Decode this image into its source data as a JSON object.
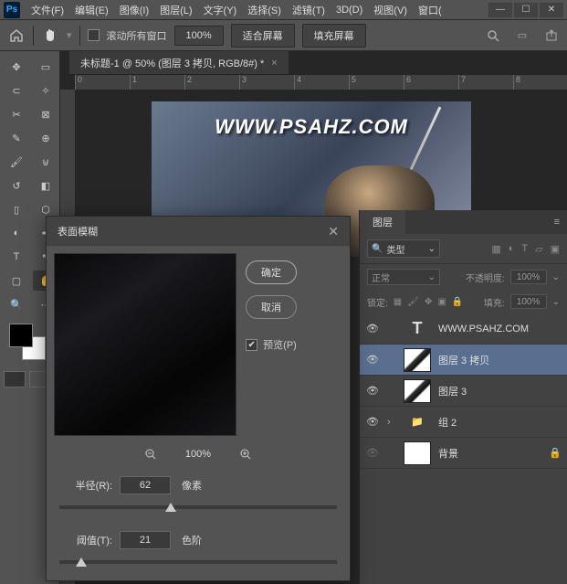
{
  "menubar": {
    "items": [
      "文件(F)",
      "编辑(E)",
      "图像(I)",
      "图层(L)",
      "文字(Y)",
      "选择(S)",
      "滤镜(T)",
      "3D(D)",
      "视图(V)",
      "窗口("
    ]
  },
  "optionsbar": {
    "scroll_all": "滚动所有窗口",
    "zoom": "100%",
    "fit_screen": "适合屏幕",
    "fill_screen": "填充屏幕"
  },
  "document": {
    "tab_title": "未标题-1 @ 50% (图层 3 拷贝, RGB/8#) *",
    "watermark": "WWW.PSAHZ.COM",
    "ruler_marks": [
      "0",
      "1",
      "2",
      "3",
      "4",
      "5",
      "6",
      "7",
      "8"
    ]
  },
  "dialog": {
    "title": "表面模糊",
    "ok": "确定",
    "cancel": "取消",
    "preview": "预览(P)",
    "zoom": "100%",
    "radius_label": "半径(R):",
    "radius_value": "62",
    "radius_unit": "像素",
    "threshold_label": "阈值(T):",
    "threshold_value": "21",
    "threshold_unit": "色阶"
  },
  "layers_panel": {
    "tab": "图层",
    "filter_type": "类型",
    "blend_mode": "正常",
    "opacity_label": "不透明度:",
    "opacity": "100%",
    "lock_label": "锁定:",
    "fill_label": "填充:",
    "fill": "100%",
    "layers": [
      {
        "name": "WWW.PSAHZ.COM",
        "type": "text",
        "visible": true
      },
      {
        "name": "图层 3 拷贝",
        "type": "pixel",
        "visible": true,
        "selected": true
      },
      {
        "name": "图层 3",
        "type": "pixel",
        "visible": true
      },
      {
        "name": "组 2",
        "type": "group",
        "visible": true
      },
      {
        "name": "背景",
        "type": "bg",
        "visible": false,
        "locked": true
      }
    ]
  },
  "chart_data": null
}
